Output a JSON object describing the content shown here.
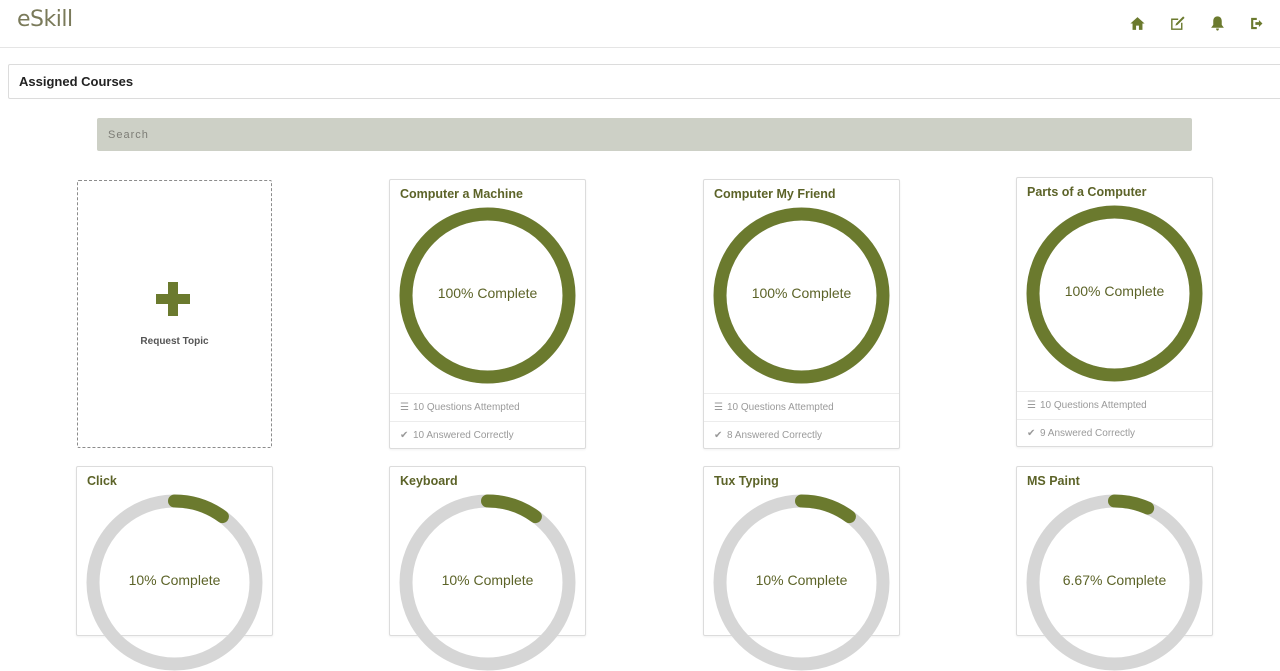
{
  "app": {
    "logo": "eSkill"
  },
  "nav": [
    {
      "icon": "home-icon"
    },
    {
      "icon": "edit-icon"
    },
    {
      "icon": "bell-icon"
    },
    {
      "icon": "sign-out-icon"
    }
  ],
  "section": {
    "title": "Assigned Courses"
  },
  "search": {
    "placeholder": "Search",
    "value": ""
  },
  "request": {
    "label": "Request Topic"
  },
  "courses": [
    {
      "title": "Computer a Machine",
      "progress": 100,
      "progress_label": "100% Complete",
      "questions": "10 Questions Attempted",
      "correct": "10 Answered Correctly"
    },
    {
      "title": "Computer My Friend",
      "progress": 100,
      "progress_label": "100% Complete",
      "questions": "10 Questions Attempted",
      "correct": "8 Answered Correctly"
    },
    {
      "title": "Parts of a Computer",
      "progress": 100,
      "progress_label": "100% Complete",
      "questions": "10 Questions Attempted",
      "correct": "9 Answered Correctly"
    },
    {
      "title": "Click",
      "progress": 10,
      "progress_label": "10% Complete"
    },
    {
      "title": "Keyboard",
      "progress": 10,
      "progress_label": "10% Complete"
    },
    {
      "title": "Tux Typing",
      "progress": 10,
      "progress_label": "10% Complete"
    },
    {
      "title": "MS Paint",
      "progress": 6.67,
      "progress_label": "6.67% Complete"
    }
  ],
  "colors": {
    "accent": "#6b7a2e",
    "track": "#d6d6d6"
  }
}
